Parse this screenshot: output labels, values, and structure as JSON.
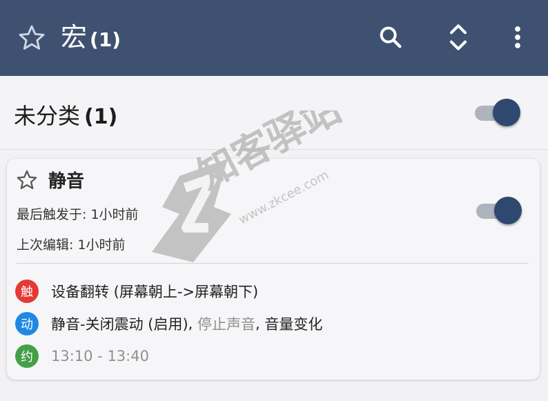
{
  "appbar": {
    "title": "宏",
    "count": "(1)",
    "icons": [
      "star-outline-icon",
      "search-icon",
      "sort-icon",
      "more-vert-icon"
    ]
  },
  "category": {
    "label": "未分类",
    "count": "(1)",
    "enabled": true
  },
  "macro": {
    "name": "静音",
    "last_triggered": "最后触发于: 1小时前",
    "last_edited": "上次编辑: 1小时前",
    "enabled": true,
    "trigger": {
      "badge": "触",
      "text": "设备翻转 (屏幕朝上->屏幕朝下)",
      "color": "#e53935"
    },
    "action": {
      "badge": "动",
      "text_main": "静音-关闭震动 (启用)",
      "sep1": ", ",
      "text_muted": "停止声音",
      "sep2": ", ",
      "text_tail": "音量变化",
      "color": "#1e88e5"
    },
    "constraint": {
      "badge": "约",
      "text": "13:10 - 13:40",
      "color": "#43a047"
    }
  },
  "watermark": {
    "brand": "知客驿站",
    "url": "www.zkcee.com"
  },
  "colors": {
    "appbar": "#3e5170",
    "toggle_on": "#2f4870"
  }
}
